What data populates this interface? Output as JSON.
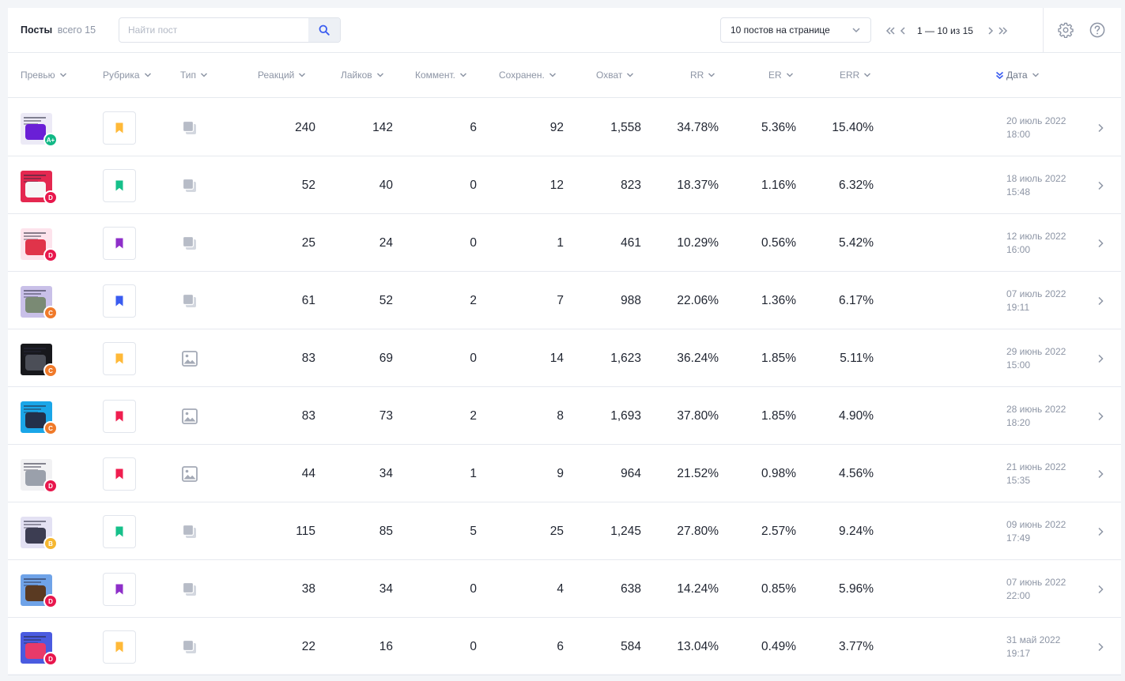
{
  "header": {
    "title": "Посты",
    "total_label": "всего 15",
    "search_placeholder": "Найти пост",
    "per_page": "10 постов на странице",
    "pagination_range": "1 — 10 из 15"
  },
  "columns": {
    "preview": "Превью",
    "rubric": "Рубрика",
    "type": "Тип",
    "reactions": "Реакций",
    "likes": "Лайков",
    "comments": "Коммент.",
    "saves": "Сохранен.",
    "reach": "Охват",
    "rr": "RR",
    "er": "ER",
    "err": "ERR",
    "date": "Дата"
  },
  "colors": {
    "grade_A": "#12b886",
    "grade_B": "#f5b731",
    "grade_C": "#f07a2a",
    "grade_D": "#e8174d",
    "rubric_orange": "#ffb938",
    "rubric_green": "#16c08a",
    "rubric_purple": "#8e2fc9",
    "rubric_blue": "#3a5cf0",
    "rubric_red": "#ef1e4f"
  },
  "rows": [
    {
      "grade": "A+",
      "grade_color": "#12b886",
      "rubric_color": "#ffb938",
      "type_icon": "carousel-icon",
      "thumb_bg": "#eceaf6",
      "thumb_blob": "#6a1fd6",
      "reactions": "240",
      "likes": "142",
      "comments": "6",
      "saves": "92",
      "reach": "1,558",
      "rr": "34.78%",
      "er": "5.36%",
      "err": "15.40%",
      "date": "20 июль 2022",
      "time": "18:00"
    },
    {
      "grade": "D",
      "grade_color": "#e8174d",
      "rubric_color": "#16c08a",
      "type_icon": "carousel-icon",
      "thumb_bg": "#e42850",
      "thumb_blob": "#f6f6f6",
      "reactions": "52",
      "likes": "40",
      "comments": "0",
      "saves": "12",
      "reach": "823",
      "rr": "18.37%",
      "er": "1.16%",
      "err": "6.32%",
      "date": "18 июль 2022",
      "time": "15:48"
    },
    {
      "grade": "D",
      "grade_color": "#e8174d",
      "rubric_color": "#8e2fc9",
      "type_icon": "carousel-icon",
      "thumb_bg": "#fde3ec",
      "thumb_blob": "#e0344a",
      "reactions": "25",
      "likes": "24",
      "comments": "0",
      "saves": "1",
      "reach": "461",
      "rr": "10.29%",
      "er": "0.56%",
      "err": "5.42%",
      "date": "12 июль 2022",
      "time": "16:00"
    },
    {
      "grade": "C",
      "grade_color": "#f07a2a",
      "rubric_color": "#3a5cf0",
      "type_icon": "carousel-icon",
      "thumb_bg": "#c9c0e8",
      "thumb_blob": "#7a8a74",
      "reactions": "61",
      "likes": "52",
      "comments": "2",
      "saves": "7",
      "reach": "988",
      "rr": "22.06%",
      "er": "1.36%",
      "err": "6.17%",
      "date": "07 июль 2022",
      "time": "19:11"
    },
    {
      "grade": "C",
      "grade_color": "#f07a2a",
      "rubric_color": "#ffb938",
      "type_icon": "image-icon",
      "thumb_bg": "#17181c",
      "thumb_blob": "#4b4e57",
      "reactions": "83",
      "likes": "69",
      "comments": "0",
      "saves": "14",
      "reach": "1,623",
      "rr": "36.24%",
      "er": "1.85%",
      "err": "5.11%",
      "date": "29 июнь 2022",
      "time": "15:00"
    },
    {
      "grade": "C",
      "grade_color": "#f07a2a",
      "rubric_color": "#ef1e4f",
      "type_icon": "image-icon",
      "thumb_bg": "#1aa6e8",
      "thumb_blob": "#23304a",
      "reactions": "83",
      "likes": "73",
      "comments": "2",
      "saves": "8",
      "reach": "1,693",
      "rr": "37.80%",
      "er": "1.85%",
      "err": "4.90%",
      "date": "28 июнь 2022",
      "time": "18:20"
    },
    {
      "grade": "D",
      "grade_color": "#e8174d",
      "rubric_color": "#ef1e4f",
      "type_icon": "image-icon",
      "thumb_bg": "#f1f1f3",
      "thumb_blob": "#9aa0ab",
      "reactions": "44",
      "likes": "34",
      "comments": "1",
      "saves": "9",
      "reach": "964",
      "rr": "21.52%",
      "er": "0.98%",
      "err": "4.56%",
      "date": "21 июнь 2022",
      "time": "15:35"
    },
    {
      "grade": "B",
      "grade_color": "#f5b731",
      "rubric_color": "#16c08a",
      "type_icon": "carousel-icon",
      "thumb_bg": "#e3e1f3",
      "thumb_blob": "#3c3d52",
      "reactions": "115",
      "likes": "85",
      "comments": "5",
      "saves": "25",
      "reach": "1,245",
      "rr": "27.80%",
      "er": "2.57%",
      "err": "9.24%",
      "date": "09 июнь 2022",
      "time": "17:49"
    },
    {
      "grade": "D",
      "grade_color": "#e8174d",
      "rubric_color": "#8e2fc9",
      "type_icon": "carousel-icon",
      "thumb_bg": "#6fa3e8",
      "thumb_blob": "#5a3a22",
      "reactions": "38",
      "likes": "34",
      "comments": "0",
      "saves": "4",
      "reach": "638",
      "rr": "14.24%",
      "er": "0.85%",
      "err": "5.96%",
      "date": "07 июнь 2022",
      "time": "22:00"
    },
    {
      "grade": "D",
      "grade_color": "#e8174d",
      "rubric_color": "#ffb938",
      "type_icon": "carousel-icon",
      "thumb_bg": "#4a5be0",
      "thumb_blob": "#e83a6a",
      "reactions": "22",
      "likes": "16",
      "comments": "0",
      "saves": "6",
      "reach": "584",
      "rr": "13.04%",
      "er": "0.49%",
      "err": "3.77%",
      "date": "31 май 2022",
      "time": "19:17"
    }
  ]
}
